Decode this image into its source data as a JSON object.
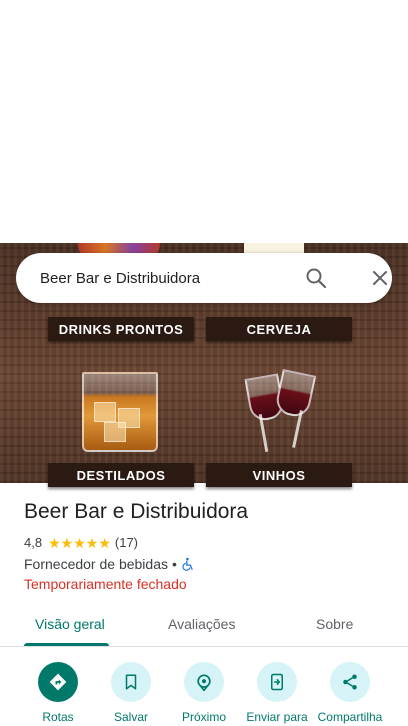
{
  "search": {
    "query": "Beer Bar e Distribuidora"
  },
  "hero": {
    "banners": [
      "DRINKS PRONTOS",
      "CERVEJA",
      "DESTILADOS",
      "VINHOS"
    ]
  },
  "place": {
    "name": "Beer Bar e Distribuidora",
    "rating": "4,8",
    "stars": 5,
    "review_count": "(17)",
    "category": "Fornecedor de bebidas",
    "separator": "•",
    "status": "Temporariamente fechado"
  },
  "tabs": [
    {
      "label": "Visão geral",
      "active": true
    },
    {
      "label": "Avaliações",
      "active": false
    },
    {
      "label": "Sobre",
      "active": false
    }
  ],
  "actions": [
    {
      "label": "Rotas",
      "icon": "directions-icon"
    },
    {
      "label": "Salvar",
      "icon": "bookmark-icon"
    },
    {
      "label": "Próximo",
      "icon": "nearby-icon"
    },
    {
      "label": "Enviar para",
      "icon": "send-to-phone-icon"
    },
    {
      "label": "Compartilha",
      "icon": "share-icon"
    }
  ],
  "colors": {
    "accent": "#00796b",
    "action_bg": "#d6f3f7",
    "status_closed": "#d93025",
    "star": "#fbbc04"
  }
}
